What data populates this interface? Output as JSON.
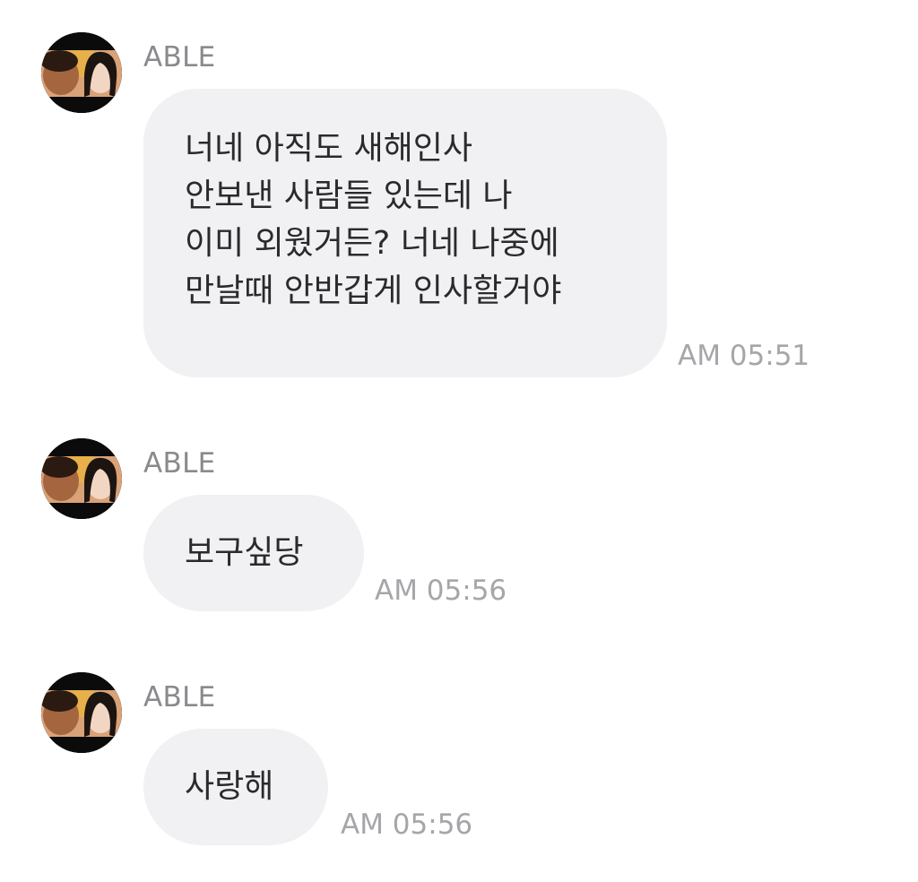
{
  "colors": {
    "background": "#ffffff",
    "bubble": "#f1f1f4",
    "sender_text": "#8a8a8e",
    "time_text": "#a6a6aa",
    "message_text": "#2a2a2c"
  },
  "messages": [
    {
      "avatar_icon": "profile-photo-icon",
      "sender": "ABLE",
      "lines": [
        "너네 아직도 새해인사",
        "안보낸 사람들 있는데 나",
        "이미 외웠거든? 너네 나중에",
        "만날때 안반갑게 인사할거야"
      ],
      "time": "AM 05:51"
    },
    {
      "avatar_icon": "profile-photo-icon",
      "sender": "ABLE",
      "lines": [
        "보구싶당"
      ],
      "time": "AM 05:56"
    },
    {
      "avatar_icon": "profile-photo-icon",
      "sender": "ABLE",
      "lines": [
        "사랑해"
      ],
      "time": "AM 05:56"
    }
  ]
}
